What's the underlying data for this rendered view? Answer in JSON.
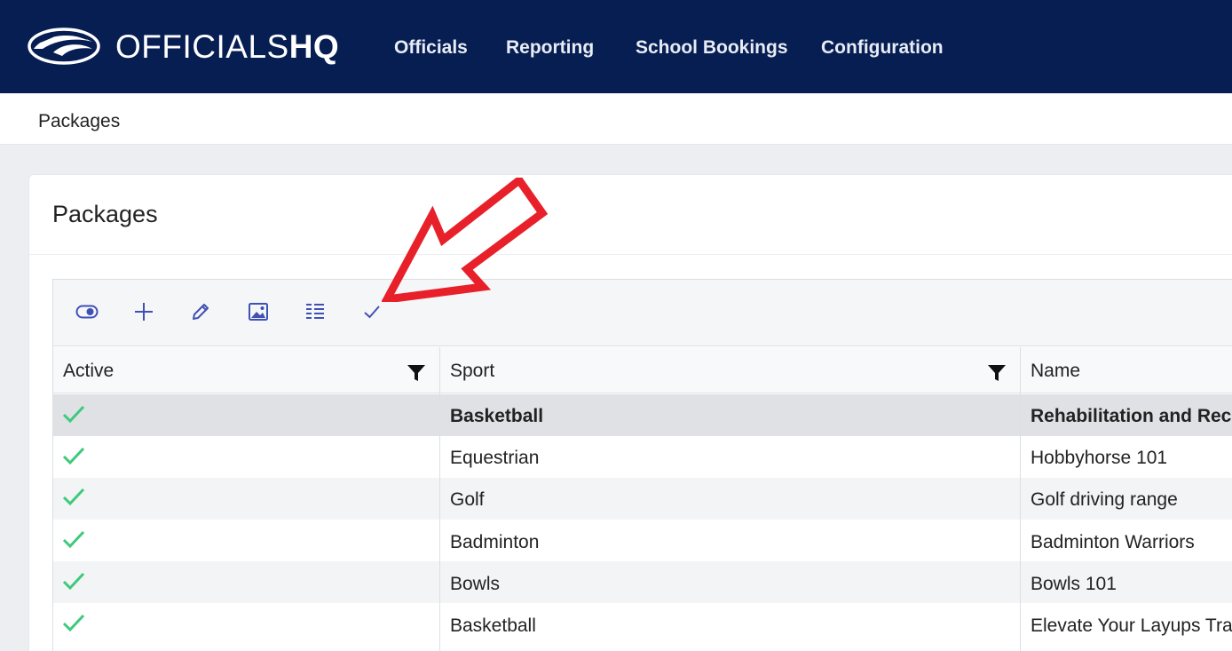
{
  "brand": {
    "name_light": "OFFICIALS",
    "name_bold": "HQ",
    "logo_icon": "officialshq-logo-icon"
  },
  "nav": [
    {
      "label": "Officials"
    },
    {
      "label": "Reporting"
    },
    {
      "label": "School Bookings"
    },
    {
      "label": "Configuration"
    }
  ],
  "breadcrumb": "Packages",
  "page_title": "Packages",
  "toolbar": {
    "icons": [
      "toggle-active-icon",
      "add-icon",
      "edit-icon",
      "image-icon",
      "list-details-icon",
      "check-icon"
    ]
  },
  "columns": [
    {
      "label": "Active"
    },
    {
      "label": "Sport"
    },
    {
      "label": "Name"
    }
  ],
  "rows": [
    {
      "active": true,
      "sport": "Basketball",
      "name": "Rehabilitation and Reco",
      "selected": true
    },
    {
      "active": true,
      "sport": "Equestrian",
      "name": "Hobbyhorse 101"
    },
    {
      "active": true,
      "sport": "Golf",
      "name": "Golf driving range"
    },
    {
      "active": true,
      "sport": "Badminton",
      "name": "Badminton Warriors"
    },
    {
      "active": true,
      "sport": "Bowls",
      "name": "Bowls 101"
    },
    {
      "active": true,
      "sport": "Basketball",
      "name": "Elevate Your Layups Trai"
    }
  ],
  "colors": {
    "nav_bg": "#071e52",
    "accent_icon": "#3f51b5",
    "check": "#3ec97b",
    "annotation_arrow": "#e8202a"
  },
  "annotation": {
    "type": "arrow",
    "points_to": "check-icon"
  }
}
